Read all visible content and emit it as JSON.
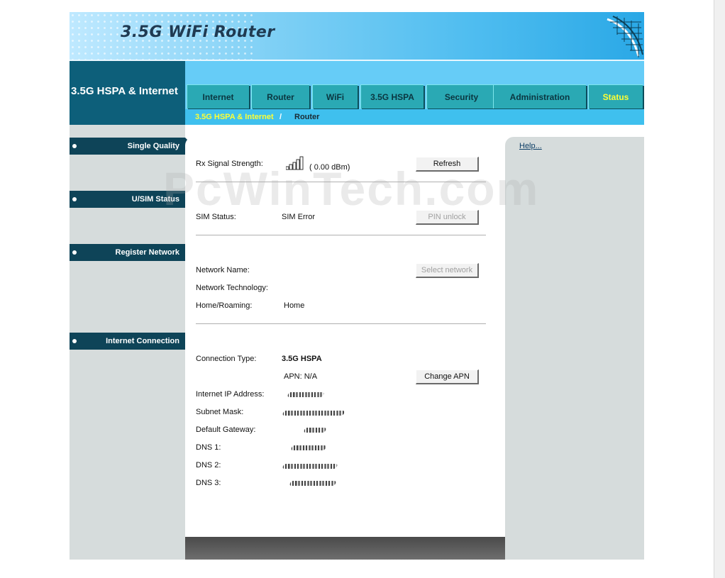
{
  "header": {
    "title": "3.5G WiFi Router"
  },
  "nav": {
    "brand": "3.5G HSPA & Internet",
    "tabs": [
      {
        "label": "Internet"
      },
      {
        "label": "Router"
      },
      {
        "label": "WiFi"
      },
      {
        "label": "3.5G HSPA"
      },
      {
        "label": "Security"
      },
      {
        "label": "Administration"
      },
      {
        "label": "Status",
        "active": true
      }
    ],
    "active_color": "#ffff33"
  },
  "breadcrumb": {
    "parent": "3.5G HSPA & Internet",
    "separator": "/",
    "current": "Router"
  },
  "sidebar": {
    "sections": [
      {
        "label": "Single Quality",
        "active": true
      },
      {
        "label": "U/SIM Status"
      },
      {
        "label": "Register Network"
      },
      {
        "label": "Internet Connection"
      }
    ]
  },
  "help": {
    "link": "Help..."
  },
  "signal": {
    "label": "Rx Signal Strength:",
    "value": "( 0.00 dBm)",
    "button": "Refresh",
    "bars_total": 5
  },
  "sim": {
    "label": "SIM Status:",
    "value": "SIM Error",
    "button": "PIN unlock"
  },
  "network": {
    "name_label": "Network Name:",
    "name_value": "",
    "button": "Select network",
    "tech_label": "Network Technology:",
    "tech_value": "",
    "roaming_label": "Home/Roaming:",
    "roaming_value": "Home"
  },
  "connection": {
    "type_label": "Connection Type:",
    "type_value": "3.5G HSPA",
    "apn": "APN: N/A",
    "button": "Change APN",
    "ip_label": "Internet IP Address:",
    "mask_label": "Subnet Mask:",
    "gateway_label": "Default Gateway:",
    "dns1_label": "DNS 1:",
    "dns2_label": "DNS 2:",
    "dns3_label": "DNS 3:"
  },
  "watermark": "PcWinTech.com",
  "colors": {
    "brand_dark": "#0d5f7a",
    "nav": "#66ccf7",
    "sidebar_header": "#0e4458",
    "panel": "#d6dcdc"
  }
}
